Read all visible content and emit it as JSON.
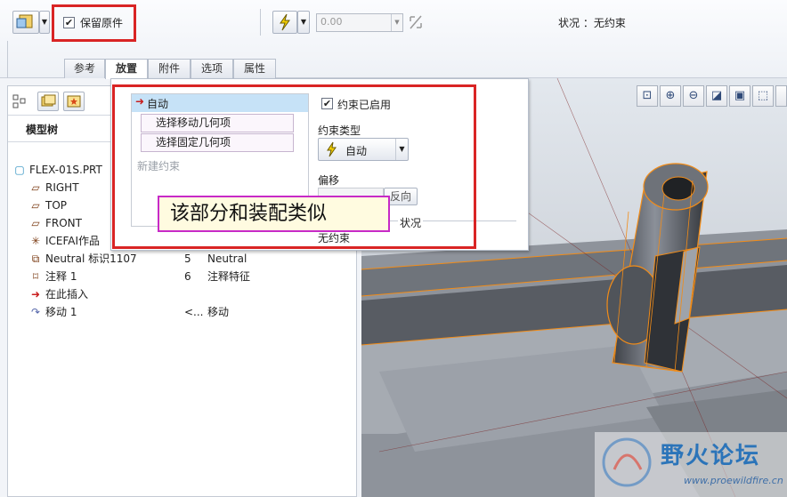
{
  "dashboard": {
    "keep_original_label": "保留原件",
    "keep_original_checked": "✔",
    "offset_value": "0.00",
    "status_label": "状况 ：无约束"
  },
  "tabs": [
    "参考",
    "放置",
    "附件",
    "选项",
    "属性"
  ],
  "tree": {
    "header": "模型树",
    "rows": [
      {
        "name": "FLEX-01S.PRT",
        "icon": "part-icon",
        "col1": "",
        "col2": ""
      },
      {
        "name": "RIGHT",
        "icon": "datum-plane-icon",
        "col1": "",
        "col2": ""
      },
      {
        "name": "TOP",
        "icon": "datum-plane-icon",
        "col1": "",
        "col2": ""
      },
      {
        "name": "FRONT",
        "icon": "datum-plane-icon",
        "col1": "",
        "col2": ""
      },
      {
        "name": "ICEFAI作品",
        "icon": "csys-icon",
        "col1": "",
        "col2": ""
      },
      {
        "name": "Neutral 标识1107",
        "icon": "import-icon",
        "col1": "5",
        "col2": "Neutral"
      },
      {
        "name": "注释 1",
        "icon": "annotation-icon",
        "col1": "6",
        "col2": "注释特征"
      },
      {
        "name": "在此插入",
        "icon": "insert-here-arrow-icon",
        "col1": "",
        "col2": ""
      },
      {
        "name": "移动 1",
        "icon": "move-icon",
        "col1": "<...",
        "col2": "移动"
      }
    ]
  },
  "placement": {
    "set_label": "自动",
    "select_move": "选择移动几何项",
    "select_fixed": "选择固定几何项",
    "new_constraint": "新建约束",
    "enabled_label": "约束已启用",
    "constraint_type_label": "约束类型",
    "constraint_type_value": "自动",
    "offset_label": "偏移",
    "flip_label": "反向",
    "status_label": "状况",
    "status_value": "无约束"
  },
  "callout": "该部分和装配类似",
  "watermark": {
    "title": "野火论坛",
    "url": "www.proewildfire.cn"
  },
  "colors": {
    "accent_red": "#d92424",
    "callout_border": "#c72ac7",
    "model_edge": "#f28c18"
  }
}
